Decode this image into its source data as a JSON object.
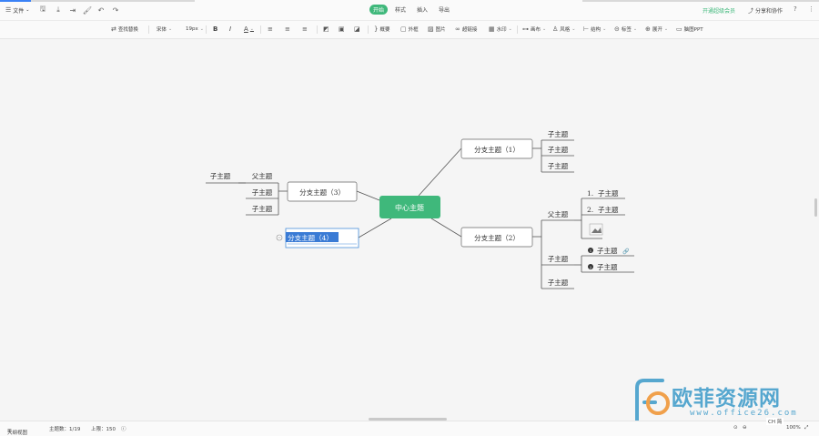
{
  "topbar": {
    "file_label": "文件",
    "tabs": [
      {
        "label": "开始",
        "active": true
      },
      {
        "label": "样式",
        "active": false
      },
      {
        "label": "插入",
        "active": false
      },
      {
        "label": "导出",
        "active": false
      }
    ],
    "vip_label": "开通超级会员",
    "share_label": "分享和协作",
    "accent_color": "#3fb87b"
  },
  "toolbar": {
    "find_replace": "查找替换",
    "font_family": "宋体",
    "font_size": "19px",
    "bold": "B",
    "italic": "I",
    "font_color": "A",
    "summary": "概要",
    "frame": "外框",
    "image": "图片",
    "hyperlink": "超链接",
    "watermark": "水印",
    "layout": "画布",
    "style": "风格",
    "structure": "结构",
    "tag": "标签",
    "expand": "展开",
    "ppt": "脑图PPT"
  },
  "mindmap": {
    "center": "中心主题",
    "branch1": "分支主题（1）",
    "branch2": "分支主题（2）",
    "branch3": "分支主题（3）",
    "branch4": "分支主题（4）",
    "sub": "子主题",
    "parent": "父主题",
    "num1": "1.",
    "num2": "2."
  },
  "status": {
    "outline": "大纲视图",
    "topic_count": "主题数：1/19",
    "limit": "上限：150",
    "zoom": "100%",
    "ime": "CH 简"
  },
  "watermark": {
    "text": "欧菲资源网",
    "url": "www.office26.com"
  }
}
